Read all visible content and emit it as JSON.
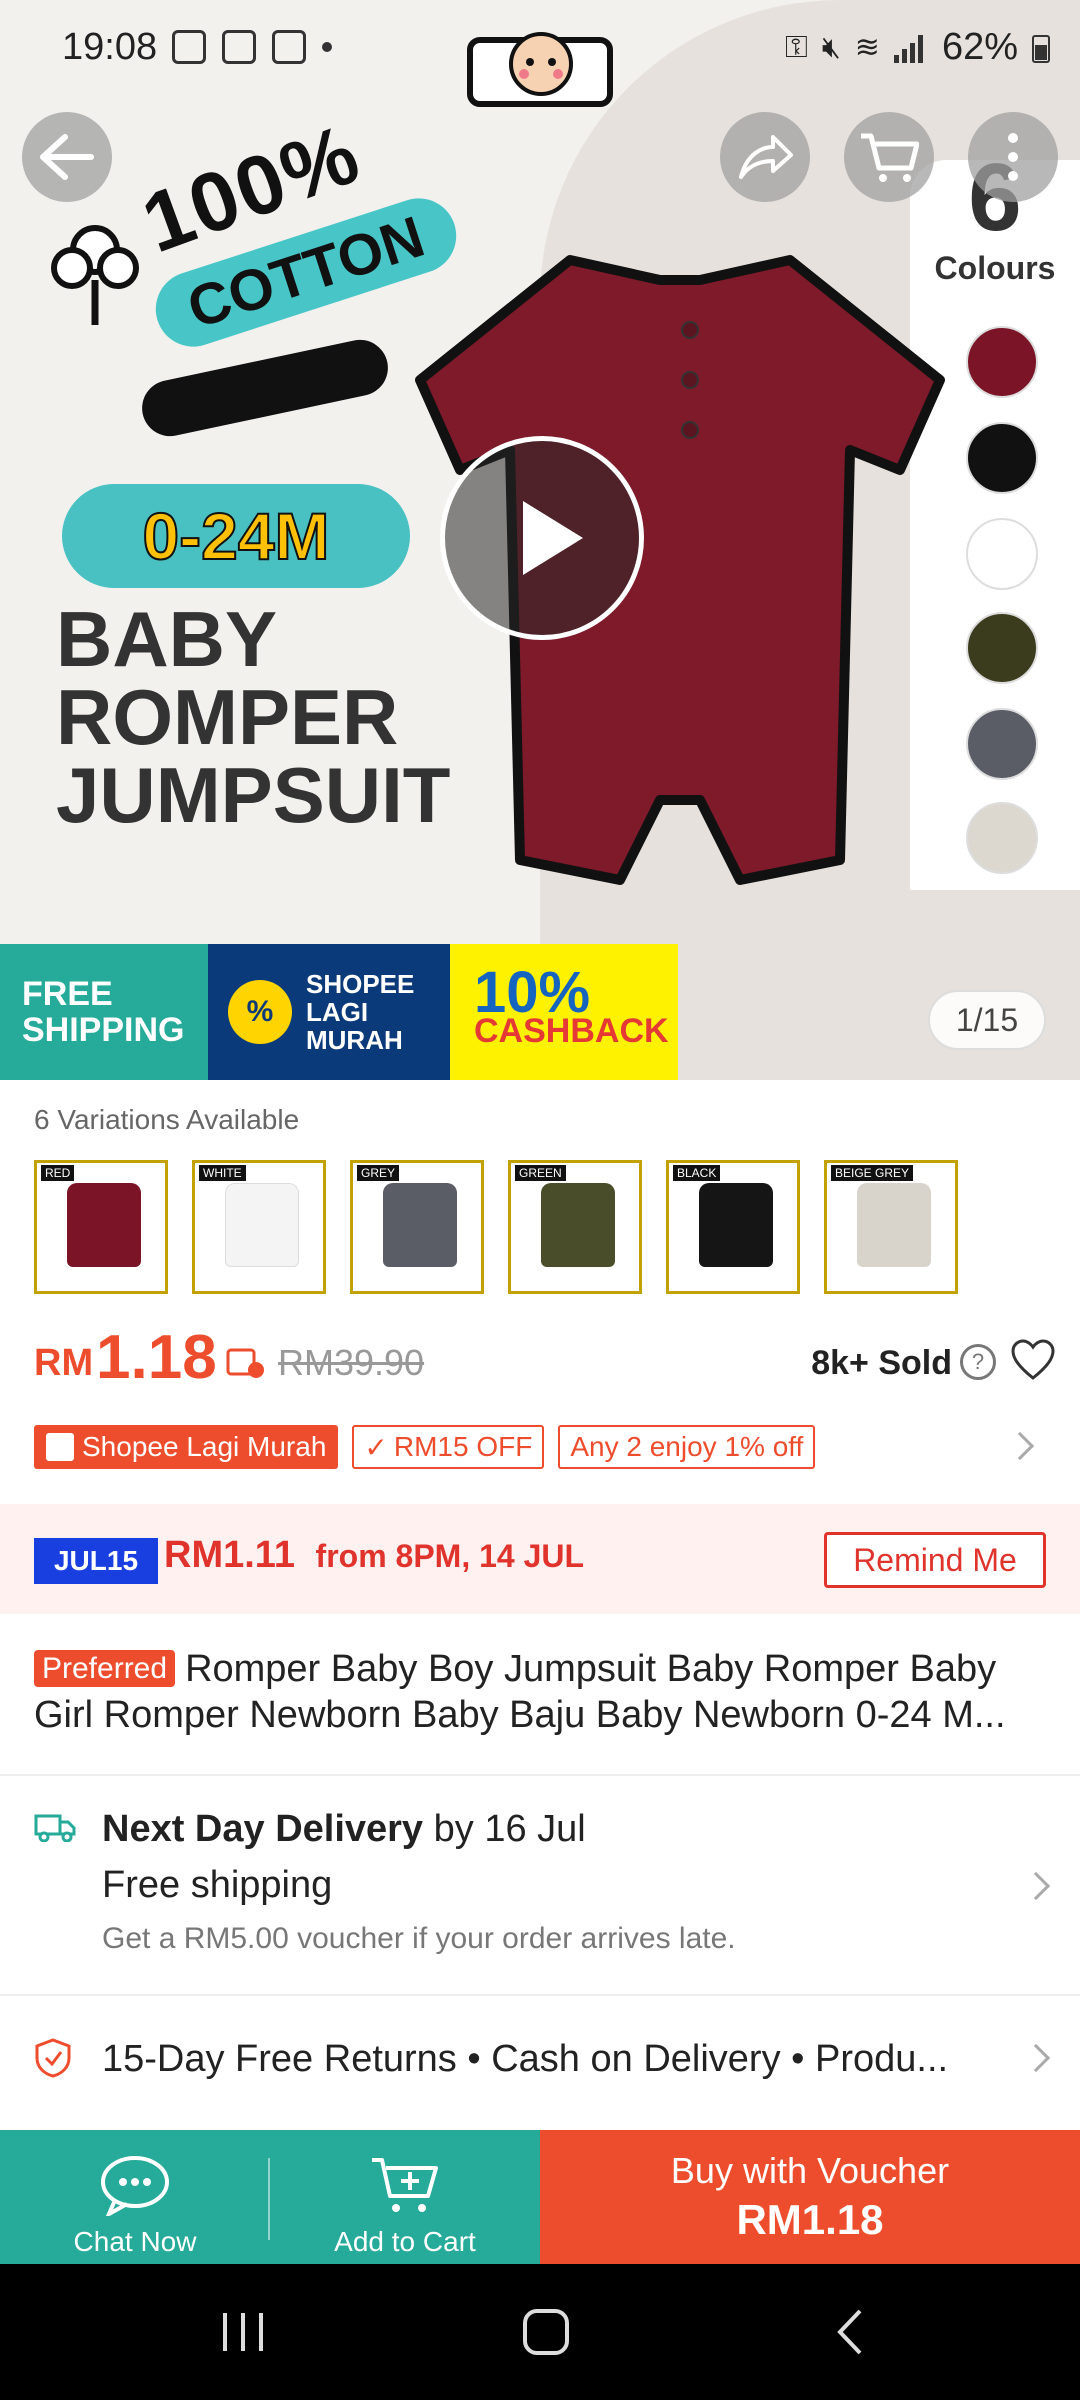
{
  "status_bar": {
    "time": "19:08",
    "battery": "62%"
  },
  "hero": {
    "cotton_label": "100%",
    "cotton_tag": "COTTON",
    "age_range": "0-24M",
    "title_lines": [
      "BABY",
      "ROMPER",
      "JUMPSUIT"
    ],
    "colours_count": "6",
    "colours_word": "Colours",
    "swatch_colors": [
      "#7b1426",
      "#111111",
      "#ffffff",
      "#3b3b1e",
      "#5a5c66",
      "#dcd8d0"
    ],
    "promo": {
      "free_shipping": [
        "FREE",
        "SHIPPING"
      ],
      "lagi_murah": [
        "SHOPEE",
        "LAGI",
        "MURAH"
      ],
      "cashback_big": "10%",
      "cashback_word": "CASHBACK"
    },
    "image_counter": "1/15"
  },
  "variations": {
    "label": "6 Variations Available",
    "items": [
      {
        "tag": "RED",
        "color": "#7b1426"
      },
      {
        "tag": "WHITE",
        "color": "#f4f4f4"
      },
      {
        "tag": "GREY",
        "color": "#5a5c66"
      },
      {
        "tag": "GREEN",
        "color": "#4a4d2a"
      },
      {
        "tag": "BLACK",
        "color": "#151515"
      },
      {
        "tag": "BEIGE GREY",
        "color": "#d8d4cc"
      }
    ]
  },
  "price": {
    "currency": "RM",
    "value": "1.18",
    "original": "RM39.90",
    "sold": "8k+ Sold"
  },
  "tags": {
    "lagi_murah": "Shopee Lagi Murah",
    "voucher": "RM15 OFF",
    "bundle": "Any 2 enjoy 1% off"
  },
  "flash": {
    "badge": "JUL15",
    "price": "RM1.11",
    "when": "from 8PM, 14 JUL",
    "remind": "Remind Me"
  },
  "product": {
    "preferred": "Preferred",
    "title": "Romper Baby Boy Jumpsuit Baby Romper Baby Girl Romper Newborn Baby Baju Baby Newborn 0-24 M..."
  },
  "delivery": {
    "title_bold": "Next Day Delivery",
    "title_rest": " by 16 Jul",
    "free": "Free shipping",
    "note": "Get a RM5.00 voucher if your order arrives late."
  },
  "returns": {
    "text": "15-Day Free Returns  •  Cash on Delivery  •  Produ..."
  },
  "bottom_bar": {
    "chat": "Chat Now",
    "cart": "Add to Cart",
    "buy_l1": "Buy with Voucher",
    "buy_l2": "RM1.18"
  },
  "colors": {
    "accent": "#ee4d2d",
    "teal": "#26aa99"
  }
}
